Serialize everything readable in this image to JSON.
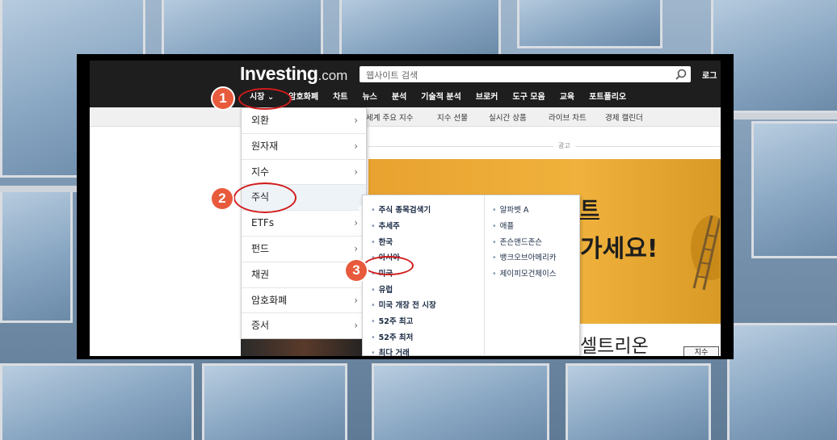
{
  "header": {
    "logo_main": "Investing",
    "logo_suffix": ".com",
    "search_placeholder": "웹사이트 검색",
    "login_label": "로그"
  },
  "nav": {
    "items": [
      "시장 ⌄",
      "암호화폐",
      "차트",
      "뉴스",
      "분석",
      "기술적 분석",
      "브로커",
      "도구 모음",
      "교육",
      "포트폴리오"
    ]
  },
  "subnav": {
    "items": [
      "세계 주요 지수",
      "지수 선물",
      "실시간 상품",
      "라이브 차트",
      "경제 캘린더"
    ]
  },
  "ad": {
    "label": "광고"
  },
  "banner": {
    "line1": "트",
    "line2": "가세요!"
  },
  "content": {
    "headline": "셀트리온",
    "tab_label": "지수"
  },
  "market_menu": {
    "items": [
      {
        "label": "외환"
      },
      {
        "label": "원자재"
      },
      {
        "label": "지수"
      },
      {
        "label": "주식"
      },
      {
        "label": "ETFs"
      },
      {
        "label": "펀드"
      },
      {
        "label": "채권"
      },
      {
        "label": "암호화폐"
      },
      {
        "label": "증서"
      }
    ]
  },
  "stocks_submenu": {
    "left": [
      "주식 종목검색기",
      "추세주",
      "한국",
      "아시아",
      "미국",
      "유럽",
      "미국 개장 전 시장",
      "52주 최고",
      "52주 최저",
      "최다 거래"
    ],
    "right": [
      "알파벳 A",
      "애플",
      "존슨앤드존슨",
      "뱅크오브아메리카",
      "제이피모건체이스"
    ]
  },
  "annotations": {
    "step1": "1",
    "step2": "2",
    "step3": "3",
    "ring_color": "#d11b1b",
    "badge_color": "#e85a3c"
  }
}
